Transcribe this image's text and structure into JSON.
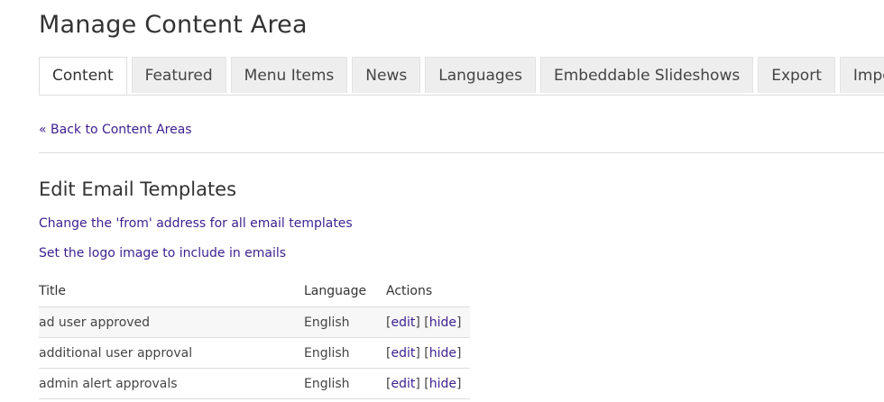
{
  "page": {
    "title": "Manage Content Area"
  },
  "tabs": [
    {
      "label": "Content",
      "active": true
    },
    {
      "label": "Featured",
      "active": false
    },
    {
      "label": "Menu Items",
      "active": false
    },
    {
      "label": "News",
      "active": false
    },
    {
      "label": "Languages",
      "active": false
    },
    {
      "label": "Embeddable Slideshows",
      "active": false
    },
    {
      "label": "Export",
      "active": false
    },
    {
      "label": "Import",
      "active": false
    }
  ],
  "back_link": "« Back to Content Areas",
  "section": {
    "heading": "Edit Email Templates",
    "links": {
      "change_from": "Change the 'from' address for all email templates",
      "set_logo": "Set the logo image to include in emails"
    }
  },
  "table": {
    "headers": {
      "title": "Title",
      "language": "Language",
      "actions": "Actions"
    },
    "rows": [
      {
        "title": "ad user approved",
        "language": "English",
        "edit": "edit",
        "hide": "hide"
      },
      {
        "title": "additional user approval",
        "language": "English",
        "edit": "edit",
        "hide": "hide"
      },
      {
        "title": "admin alert approvals",
        "language": "English",
        "edit": "edit",
        "hide": "hide"
      }
    ]
  },
  "colors": {
    "link": "#3d1f8f",
    "text": "#333333",
    "tab_inactive_bg": "#eeeeee",
    "border": "#dddddd"
  }
}
